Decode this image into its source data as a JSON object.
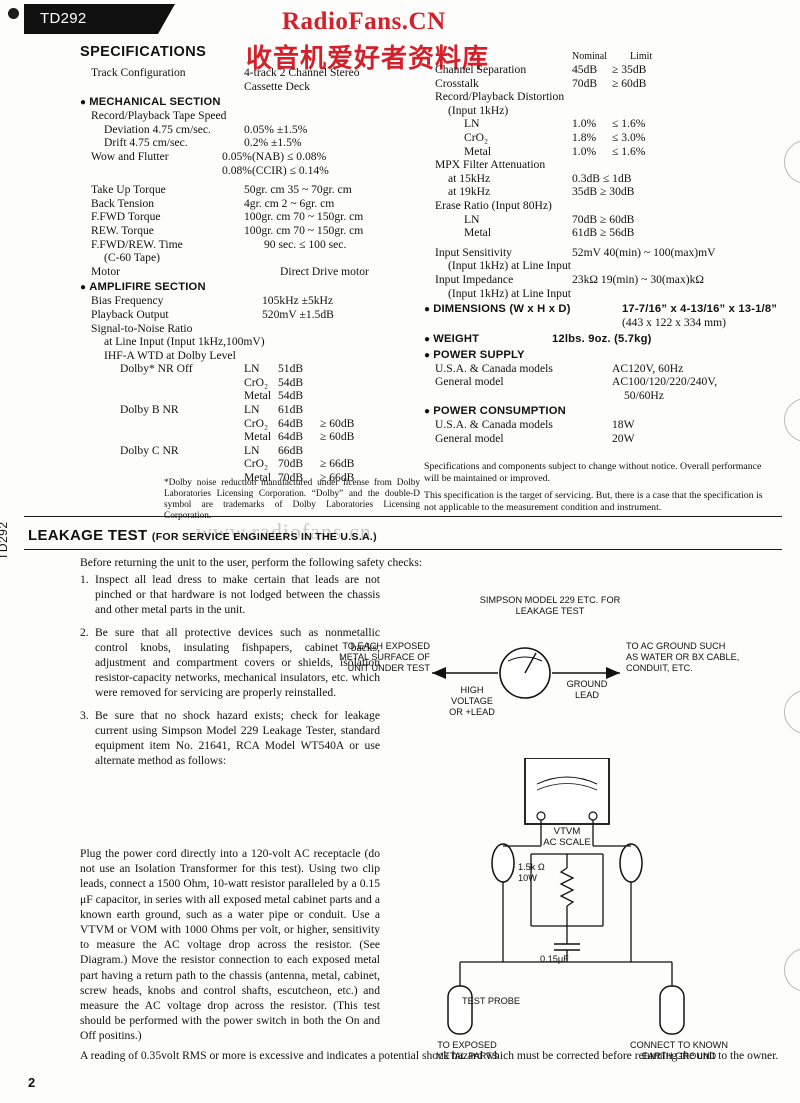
{
  "page": {
    "model": "TD292",
    "side_label": "TD292",
    "page_number": "2",
    "watermark_line1": "RadioFans.CN",
    "watermark_line2": "收音机爱好者资料库",
    "watermark_faint": "www.radiofans.cn"
  },
  "specifications": {
    "title": "SPECIFICATIONS",
    "left": [
      {
        "indent": 1,
        "label": "Track Configuration",
        "value": "4-track 2 Channel Stereo",
        "vx": 164
      },
      {
        "indent": 1,
        "label": "",
        "value": "Cassette Deck",
        "vx": 164
      },
      {
        "section": "MECHANICAL SECTION"
      },
      {
        "indent": 1,
        "label": "Record/Playback Tape Speed",
        "value": ""
      },
      {
        "indent": 2,
        "label": "Deviation 4.75 cm/sec.",
        "value": "0.05%  ±1.5%",
        "vx": 164
      },
      {
        "indent": 2,
        "label": "Drift 4.75 cm/sec.",
        "value": "0.2%  ±1.5%",
        "vx": 164
      },
      {
        "indent": 1,
        "label": "Wow and Flutter",
        "value": "0.05%(NAB) ≤ 0.08%",
        "vx": 142
      },
      {
        "indent": 1,
        "label": "",
        "value": "0.08%(CCIR) ≤ 0.14%",
        "vx": 142
      },
      {
        "blank": true
      },
      {
        "indent": 1,
        "label": "Take Up Torque",
        "value": "50gr. cm  35 ~ 70gr. cm",
        "vx": 164
      },
      {
        "indent": 1,
        "label": "Back Tension",
        "value": "4gr. cm   2 ~ 6gr. cm",
        "vx": 164
      },
      {
        "indent": 1,
        "label": "F.FWD Torque",
        "value": "100gr. cm  70 ~ 150gr. cm",
        "vx": 164
      },
      {
        "indent": 1,
        "label": "REW. Torque",
        "value": "100gr. cm  70 ~ 150gr. cm",
        "vx": 164
      },
      {
        "indent": 1,
        "label": "F.FWD/REW. Time",
        "value": "90 sec. ≤ 100 sec.",
        "vx": 184
      },
      {
        "indent": 2,
        "label": "(C-60 Tape)",
        "value": ""
      },
      {
        "indent": 1,
        "label": "Motor",
        "value": "Direct Drive motor",
        "vx": 200
      },
      {
        "section": "AMPLIFIRE SECTION"
      },
      {
        "indent": 1,
        "label": "Bias Frequency",
        "value": "105kHz ±5kHz",
        "vx": 182
      },
      {
        "indent": 1,
        "label": "Playback Output",
        "value": "520mV ±1.5dB",
        "vx": 182
      },
      {
        "indent": 1,
        "label": "Signal-to-Noise Ratio",
        "value": ""
      },
      {
        "indent": 2,
        "label": "at Line Input (Input 1kHz,100mV)",
        "value": ""
      },
      {
        "indent": 2,
        "label": "IHF-A WTD at Dolby Level",
        "value": ""
      },
      {
        "indent": 3,
        "label": "Dolby* NR Off",
        "value": "LN",
        "vx": 164,
        "value2": "51dB",
        "vx2": 198
      },
      {
        "indent": 3,
        "label": "",
        "value": "CrO₂",
        "vx": 164,
        "value2": "54dB",
        "vx2": 198
      },
      {
        "indent": 3,
        "label": "",
        "value": "Metal",
        "vx": 164,
        "value2": "54dB",
        "vx2": 198
      },
      {
        "indent": 3,
        "label": "Dolby B NR",
        "value": "LN",
        "vx": 164,
        "value2": "61dB",
        "vx2": 198
      },
      {
        "indent": 3,
        "label": "",
        "value": "CrO₂",
        "vx": 164,
        "value2": "64dB",
        "vx2": 198,
        "value3": "≥ 60dB",
        "vx3": 240
      },
      {
        "indent": 3,
        "label": "",
        "value": "Metal",
        "vx": 164,
        "value2": "64dB",
        "vx2": 198,
        "value3": "≥ 60dB",
        "vx3": 240
      },
      {
        "indent": 3,
        "label": "Dolby C NR",
        "value": "LN",
        "vx": 164,
        "value2": "66dB",
        "vx2": 198
      },
      {
        "indent": 3,
        "label": "",
        "value": "CrO₂",
        "vx": 164,
        "value2": "70dB",
        "vx2": 198,
        "value3": "≥ 66dB",
        "vx3": 240
      },
      {
        "indent": 3,
        "label": "",
        "value": "Metal",
        "vx": 164,
        "value2": "70dB",
        "vx2": 198,
        "value3": "≥ 66dB",
        "vx3": 240
      }
    ],
    "left_footnote": "*Dolby noise reduction manufactured under license from Dolby Laboratories Licensing Corporation. “Dolby” and the double-D symbol are trademarks of Dolby Laboratories Licensing Corporation.",
    "right_headers": {
      "nominal": "Nominal",
      "limit": "Limit",
      "nominal_x": 148,
      "limit_x": 206
    },
    "right": [
      {
        "indent": 1,
        "label": "Channel Separation",
        "value": "45dB",
        "vx": 148,
        "value2": "≥ 35dB",
        "vx2": 188
      },
      {
        "indent": 1,
        "label": "Crosstalk",
        "value": "70dB",
        "vx": 148,
        "value2": "≥ 60dB",
        "vx2": 188
      },
      {
        "indent": 1,
        "label": "Record/Playback Distortion",
        "value": ""
      },
      {
        "indent": 2,
        "label": "(Input 1kHz)",
        "value": ""
      },
      {
        "indent": 3,
        "label": "LN",
        "value": "1.0%",
        "vx": 148,
        "value2": "≤ 1.6%",
        "vx2": 188
      },
      {
        "indent": 3,
        "label": "CrO₂",
        "value": "1.8%",
        "vx": 148,
        "value2": "≤ 3.0%",
        "vx2": 188
      },
      {
        "indent": 3,
        "label": "Metal",
        "value": "1.0%",
        "vx": 148,
        "value2": "≤ 1.6%",
        "vx2": 188
      },
      {
        "indent": 1,
        "label": "MPX Filter Attenuation",
        "value": ""
      },
      {
        "indent": 2,
        "label": "at 15kHz",
        "value": "0.3dB ≤ 1dB",
        "vx": 148
      },
      {
        "indent": 2,
        "label": "at 19kHz",
        "value": "35dB ≥ 30dB",
        "vx": 148
      },
      {
        "indent": 1,
        "label": "Erase Ratio (Input 80Hz)",
        "value": ""
      },
      {
        "indent": 3,
        "label": "LN",
        "value": "70dB ≥ 60dB",
        "vx": 148
      },
      {
        "indent": 3,
        "label": "Metal",
        "value": "61dB ≥ 56dB",
        "vx": 148
      },
      {
        "blank": true
      },
      {
        "indent": 1,
        "label": "Input Sensitivity",
        "value": "52mV  40(min) ~ 100(max)mV",
        "vx": 148
      },
      {
        "indent": 2,
        "label": "(Input 1kHz) at Line Input",
        "value": ""
      },
      {
        "indent": 1,
        "label": "Input Impedance",
        "value": "23kΩ  19(min) ~ 30(max)kΩ",
        "vx": 148
      },
      {
        "indent": 2,
        "label": "(Input 1kHz) at Line Input",
        "value": ""
      },
      {
        "section": "DIMENSIONS (W x H x D)",
        "value": "17-7/16” x 4-13/16” x 13-1/8”",
        "vx": 198
      },
      {
        "indent": 2,
        "label": "",
        "value": "(443 x 122 x 334 mm)",
        "vx": 198
      },
      {
        "section": "WEIGHT",
        "value": "12lbs. 9oz. (5.7kg)",
        "vx": 128
      },
      {
        "section": "POWER SUPPLY"
      },
      {
        "indent": 1,
        "label": "U.S.A. & Canada models",
        "value": "AC120V, 60Hz",
        "vx": 188
      },
      {
        "indent": 1,
        "label": "General model",
        "value": "AC100/120/220/240V,",
        "vx": 188
      },
      {
        "indent": 1,
        "label": "",
        "value": "50/60Hz",
        "vx": 200
      },
      {
        "section": "POWER CONSUMPTION"
      },
      {
        "indent": 1,
        "label": "U.S.A. & Canada models",
        "value": "18W",
        "vx": 188
      },
      {
        "indent": 1,
        "label": "General model",
        "value": "20W",
        "vx": 188
      }
    ],
    "note_a": "Specifications and components subject to change without notice. Overall performance will be maintained or improved.",
    "note_b": "This specification is the target of servicing. But, there is a case that the specification is not applicable to the measurement condition and instrument."
  },
  "leakage": {
    "heading": "LEAKAGE TEST",
    "heading_sub": "(FOR SERVICE ENGINEERS IN THE U.S.A.)",
    "intro": "Before returning the unit to the user, perform the following safety checks:",
    "items": [
      {
        "num": "1.",
        "text": "Inspect all lead dress to make certain that leads are not pinched or that hardware is not lodged between the chassis and other metal parts in the unit."
      },
      {
        "num": "2.",
        "text": "Be sure that all protective devices such as nonmetallic control knobs, insulating fishpapers, cabinet backs, adjustment and compartment covers or shields, isolation resistor-capacity networks, mechanical insulators, etc. which were removed for servicing are properly reinstalled."
      },
      {
        "num": "3.",
        "text": "Be sure that no shock hazard exists; check for leakage current using Simpson Model 229 Leakage Tester, standard equipment item No. 21641, RCA Model WT540A or use alternate method as follows:"
      }
    ],
    "paragraph": "Plug the power cord directly into a 120-volt AC receptacle (do not use an Isolation Transformer for this test). Using two clip leads, connect a 1500 Ohm, 10-watt resistor paralleled by a 0.15 μF capacitor, in series with all exposed metal cabinet parts and a known earth ground, such as a water pipe or conduit. Use a VTVM or VOM with 1000 Ohms per volt, or higher, sensitivity to measure the AC voltage drop across the resistor. (See Diagram.) Move the resistor connection to each exposed metal part having a return path to the chassis (antenna, metal, cabinet, screw heads, knobs and control shafts, escutcheon, etc.) and measure the AC voltage drop across the resistor. (This test should be performed with the power switch in both the On and Off positins.)",
    "closing": "A reading of 0.35volt RMS or more is excessive and indicates a potential shock hazard which must be corrected before returning the unit to the owner."
  },
  "diagram_top": {
    "title": "SIMPSON MODEL 229 ETC. FOR\nLEAKAGE TEST",
    "left_label": "TO EACH EXPOSED\nMETAL SURFACE OF\nUNIT UNDER TEST",
    "right_label": "TO AC GROUND SUCH\nAS WATER OR BX CABLE,\nCONDUIT, ETC.",
    "hv_label": "HIGH\nVOLTAGE\nOR +LEAD",
    "ground_label": "GROUND\nLEAD"
  },
  "diagram_bottom": {
    "meter_label_1": "VTVM",
    "meter_label_2": "AC SCALE",
    "resistor_label": "1.5k Ω\n10W",
    "capacitor_label": "0.15μF",
    "probe_label": "TEST PROBE",
    "left_label": "TO EXPOSED\nMETAL PARTS",
    "right_label": "CONNECT TO KNOWN\nEARTH GROUND"
  }
}
